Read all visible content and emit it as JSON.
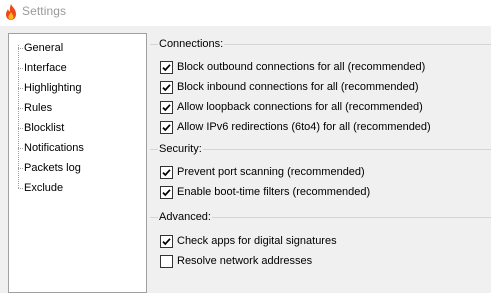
{
  "window": {
    "title": "Settings",
    "icon": "flame-icon"
  },
  "nav": {
    "items": [
      {
        "label": "General"
      },
      {
        "label": "Interface"
      },
      {
        "label": "Highlighting"
      },
      {
        "label": "Rules",
        "selected": true
      },
      {
        "label": "Blocklist"
      },
      {
        "label": "Notifications"
      },
      {
        "label": "Packets log"
      },
      {
        "label": "Exclude"
      }
    ]
  },
  "connections": {
    "label": "Connections:",
    "options": [
      {
        "label": "Block outbound connections for all (recommended)",
        "checked": true
      },
      {
        "label": "Block inbound connections for all (recommended)",
        "checked": true
      },
      {
        "label": "Allow loopback connections for all (recommended)",
        "checked": true
      },
      {
        "label": "Allow IPv6 redirections (6to4) for all (recommended)",
        "checked": true
      }
    ]
  },
  "security": {
    "label": "Security:",
    "options": [
      {
        "label": "Prevent port scanning (recommended)",
        "checked": true
      },
      {
        "label": "Enable boot-time filters (recommended)",
        "checked": true
      }
    ]
  },
  "advanced": {
    "label": "Advanced:",
    "options": [
      {
        "label": "Check apps for digital signatures",
        "checked": true
      },
      {
        "label": "Resolve network addresses",
        "checked": false
      }
    ]
  },
  "colors": {
    "checkmark": "#000000",
    "border": "#333333",
    "title": "#9a9a9a"
  }
}
